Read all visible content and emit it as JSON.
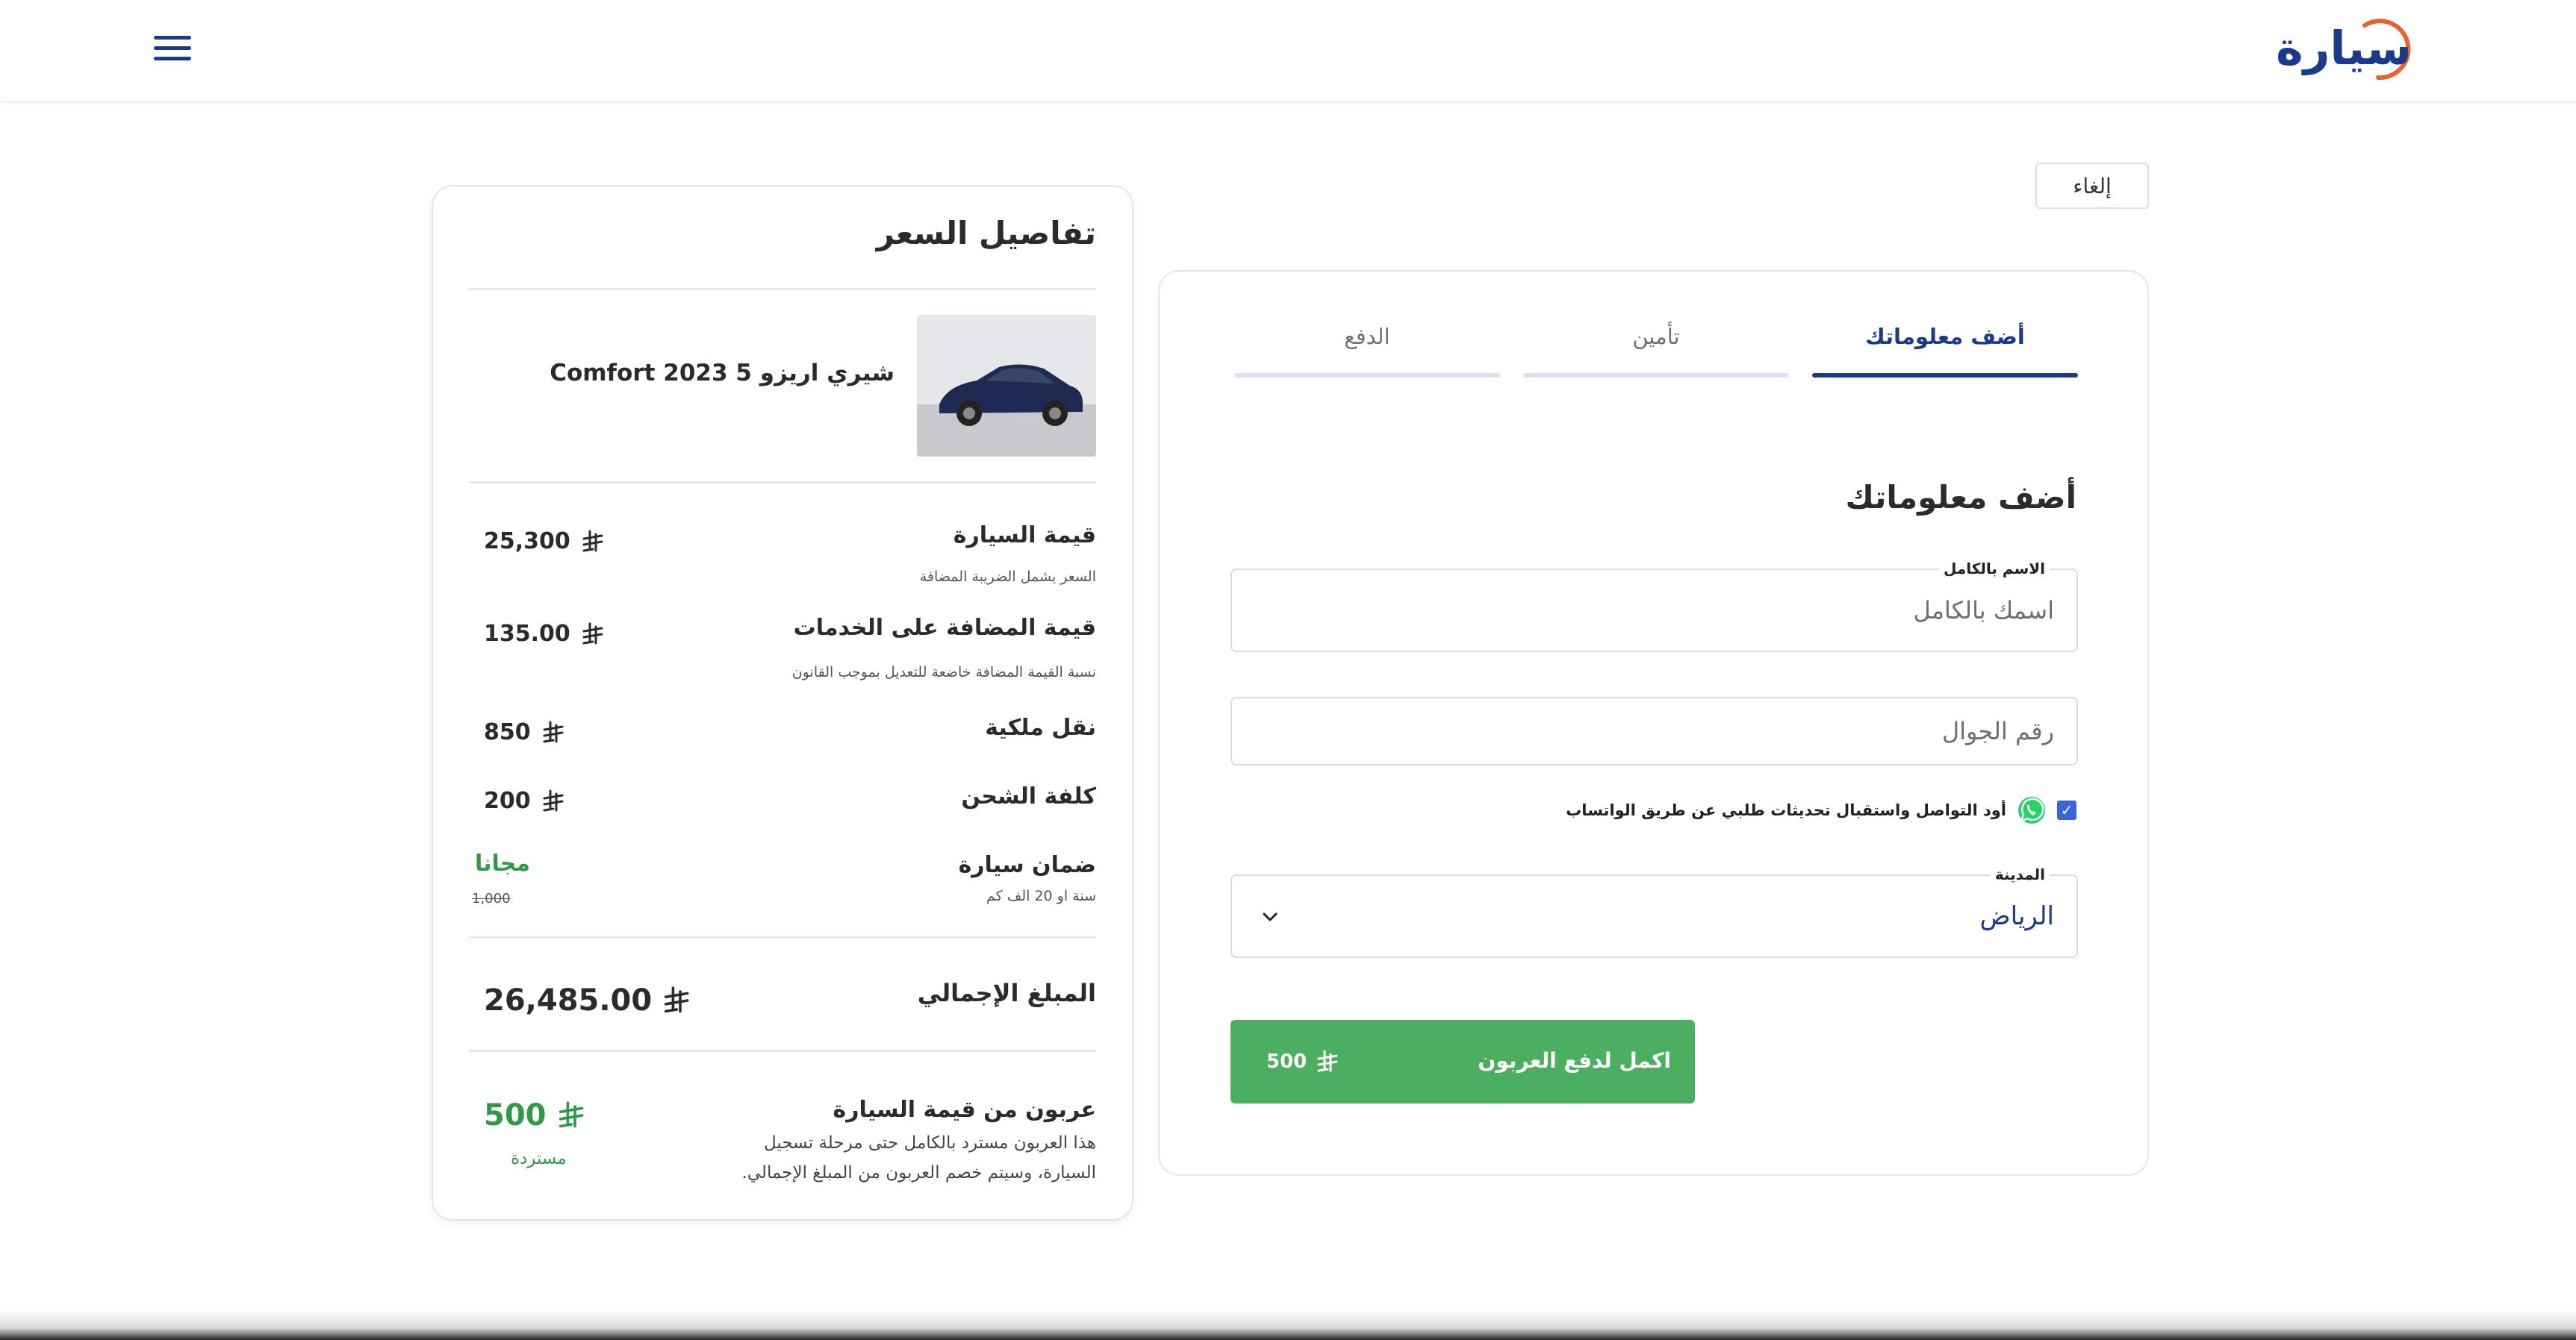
{
  "header": {
    "logo_text": "سيارة",
    "menu_icon": "hamburger-menu-icon"
  },
  "cancel_label": "إلغاء",
  "colors": {
    "brand": "#1b3a8a",
    "accent_orange": "#e8622c",
    "success_green": "#4caf60"
  },
  "form": {
    "tabs": [
      {
        "label": "أضف معلوماتك",
        "active": true
      },
      {
        "label": "تأمين",
        "active": false
      },
      {
        "label": "الدفع",
        "active": false
      }
    ],
    "title": "أضف معلوماتك",
    "full_name": {
      "label": "الاسم بالكامل",
      "placeholder": "اسمك بالكامل"
    },
    "phone": {
      "placeholder": "رقم الجوال"
    },
    "whatsapp": {
      "checked": true,
      "text": "أود التواصل واستقبال تحديثات طلبي عن طريق الواتساب"
    },
    "city": {
      "label": "المدينة",
      "value": "الرياض"
    },
    "submit": {
      "label": "اكمل لدفع العربون",
      "amount": "500"
    }
  },
  "price": {
    "title": "تفاصيل السعر",
    "car_name": "شيري اريزو 5 2023 Comfort",
    "rows": [
      {
        "label": "قيمة السيارة",
        "sub": "السعر يشمل الضريبة المضافة",
        "value": "25,300"
      },
      {
        "label": "قيمة المضافة على الخدمات",
        "sub": "نسبة القيمة المضافة خاضعة للتعديل بموجب القانون",
        "value": "135.00"
      },
      {
        "label": "نقل ملكية",
        "value": "850"
      },
      {
        "label": "كلفة الشحن",
        "value": "200"
      },
      {
        "label": "ضمان سيارة",
        "sub": "سنة او 20 الف كم",
        "value": "مجانا",
        "original": "1,000"
      }
    ],
    "total": {
      "label": "المبلغ الإجمالي",
      "value": "26,485.00"
    },
    "deposit": {
      "title": "عربون من قيمة السيارة",
      "desc": "هذا العربون مسترد بالكامل حتى مرحلة تسجيل السيارة، وسيتم خصم العربون من المبلغ الإجمالي.",
      "value": "500",
      "note": "مستردة"
    }
  }
}
